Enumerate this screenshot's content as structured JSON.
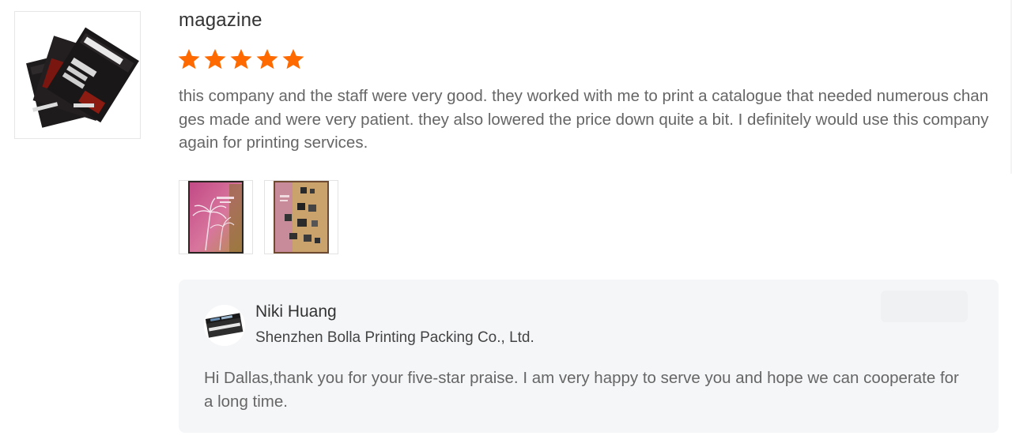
{
  "review": {
    "product_image": "magazine-cover-thumbnail",
    "title": "magazine",
    "rating": 5,
    "rating_max": 5,
    "star_color": "#ff6a00",
    "text": "this company and the staff were very good. they worked with me to print a catalogue that needed numerous changes made and were very patient. they also lowered the price down quite a bit. I definitely would use this company again for printing services.",
    "photos": [
      {
        "name": "palm-tree-catalogue-cover-photo"
      },
      {
        "name": "catalogue-spread-photo"
      }
    ]
  },
  "reply": {
    "author": "Niki Huang",
    "company": "Shenzhen Bolla Printing Packing Co., Ltd.",
    "text": "Hi Dallas,thank you for your five-star praise. I am very happy to serve you and hope we can cooperate for a long time.",
    "background": "#f5f6f8"
  }
}
